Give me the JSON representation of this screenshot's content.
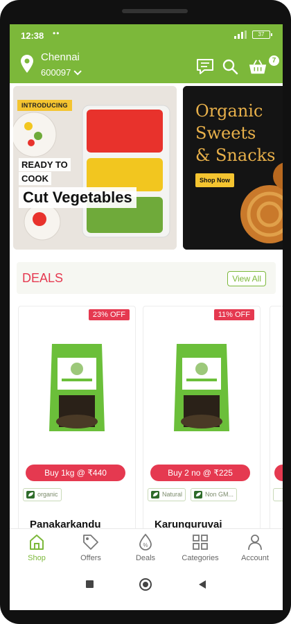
{
  "status": {
    "time": "12:38",
    "dots": "••",
    "battery": "37"
  },
  "location": {
    "city": "Chennai",
    "pincode": "600097"
  },
  "cart": {
    "count": "7"
  },
  "banners": {
    "left": {
      "tag": "INTRODUCING",
      "line1": "READY TO",
      "line2": "COOK",
      "headline": "Cut Vegetables"
    },
    "right": {
      "title_line1": "Organic",
      "title_line2": "Sweets",
      "title_line3": "& Snacks",
      "button": "Shop Now"
    }
  },
  "deals": {
    "title": "DEALS",
    "view_all": "View All"
  },
  "products": [
    {
      "name": "Panakarkandu",
      "discount": "23% OFF",
      "buy_label": "Buy 1kg @ ₹440",
      "tags": [
        "organic"
      ]
    },
    {
      "name": "Karunguruvai",
      "discount": "11% OFF",
      "buy_label": "Buy 2 no @ ₹225",
      "tags": [
        "Natural",
        "Non GM..."
      ]
    }
  ],
  "nav": [
    {
      "label": "Shop",
      "icon": "shop-icon",
      "active": true
    },
    {
      "label": "Offers",
      "icon": "tag-icon",
      "active": false
    },
    {
      "label": "Deals",
      "icon": "percent-drop-icon",
      "active": false
    },
    {
      "label": "Categories",
      "icon": "grid-icon",
      "active": false
    },
    {
      "label": "Account",
      "icon": "user-icon",
      "active": false
    }
  ],
  "colors": {
    "brand_green": "#7cb83a",
    "deal_red": "#e53950",
    "banner_yellow": "#f4c430"
  }
}
